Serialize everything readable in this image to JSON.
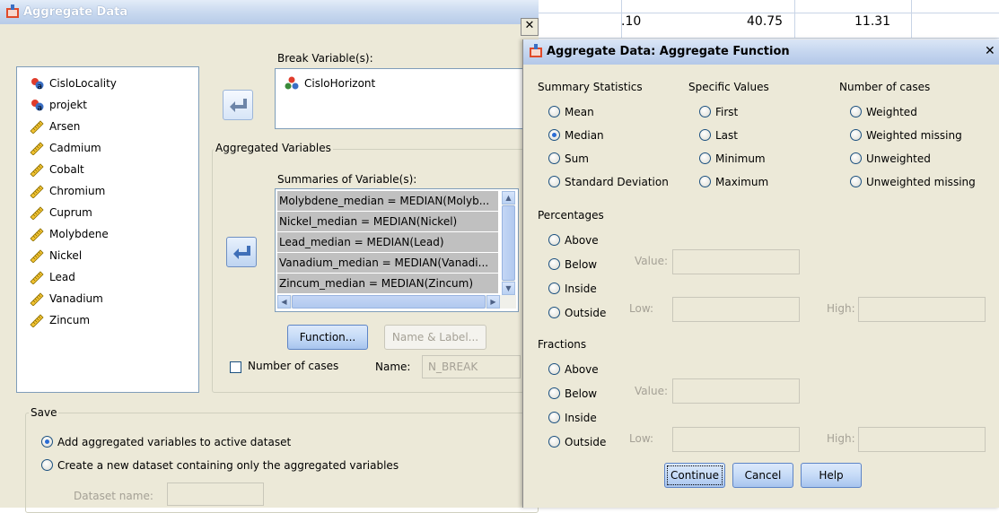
{
  "main_dialog": {
    "title": "Aggregate Data",
    "source_variables": [
      {
        "label": "CisloLocality",
        "icon": "nominal-variable-icon"
      },
      {
        "label": "projekt",
        "icon": "nominal-variable-icon"
      },
      {
        "label": "Arsen",
        "icon": "scale-variable-icon"
      },
      {
        "label": "Cadmium",
        "icon": "scale-variable-icon"
      },
      {
        "label": "Cobalt",
        "icon": "scale-variable-icon"
      },
      {
        "label": "Chromium",
        "icon": "scale-variable-icon"
      },
      {
        "label": "Cuprum",
        "icon": "scale-variable-icon"
      },
      {
        "label": "Molybdene",
        "icon": "scale-variable-icon"
      },
      {
        "label": "Nickel",
        "icon": "scale-variable-icon"
      },
      {
        "label": "Lead",
        "icon": "scale-variable-icon"
      },
      {
        "label": "Vanadium",
        "icon": "scale-variable-icon"
      },
      {
        "label": "Zincum",
        "icon": "scale-variable-icon"
      }
    ],
    "break_variables_label": "Break Variable(s):",
    "break_variables": [
      "CisloHorizont"
    ],
    "aggregated_group_label": "Aggregated Variables",
    "summaries_label": "Summaries of Variable(s):",
    "summaries": [
      "Molybdene_median = MEDIAN(Molyb...",
      "Nickel_median = MEDIAN(Nickel)",
      "Lead_median = MEDIAN(Lead)",
      "Vanadium_median = MEDIAN(Vanadi...",
      "Zincum_median = MEDIAN(Zincum)"
    ],
    "function_button": "Function...",
    "name_label_button": "Name & Label...",
    "number_of_cases_label": "Number of cases",
    "name_label": "Name:",
    "name_value": "N_BREAK",
    "save_group_label": "Save",
    "save_option_add": "Add aggregated variables to active dataset",
    "save_option_create": "Create a new dataset containing only the aggregated variables",
    "dataset_name_label": "Dataset name:"
  },
  "background_grid": {
    "values": [
      ".10",
      "40.75",
      "11.31"
    ]
  },
  "function_dialog": {
    "title": "Aggregate Data: Aggregate Function",
    "summary_statistics_label": "Summary Statistics",
    "summary_statistics": [
      "Mean",
      "Median",
      "Sum",
      "Standard Deviation"
    ],
    "selected_statistic": "Median",
    "specific_values_label": "Specific Values",
    "specific_values": [
      "First",
      "Last",
      "Minimum",
      "Maximum"
    ],
    "number_of_cases_label": "Number of cases",
    "number_of_cases_options": [
      "Weighted",
      "Weighted missing",
      "Unweighted",
      "Unweighted missing"
    ],
    "percentages_label": "Percentages",
    "fractions_label": "Fractions",
    "range_options": [
      "Above",
      "Below",
      "Inside",
      "Outside"
    ],
    "value_label": "Value:",
    "low_label": "Low:",
    "high_label": "High:",
    "continue_button": "Continue",
    "cancel_button": "Cancel",
    "help_button": "Help"
  }
}
